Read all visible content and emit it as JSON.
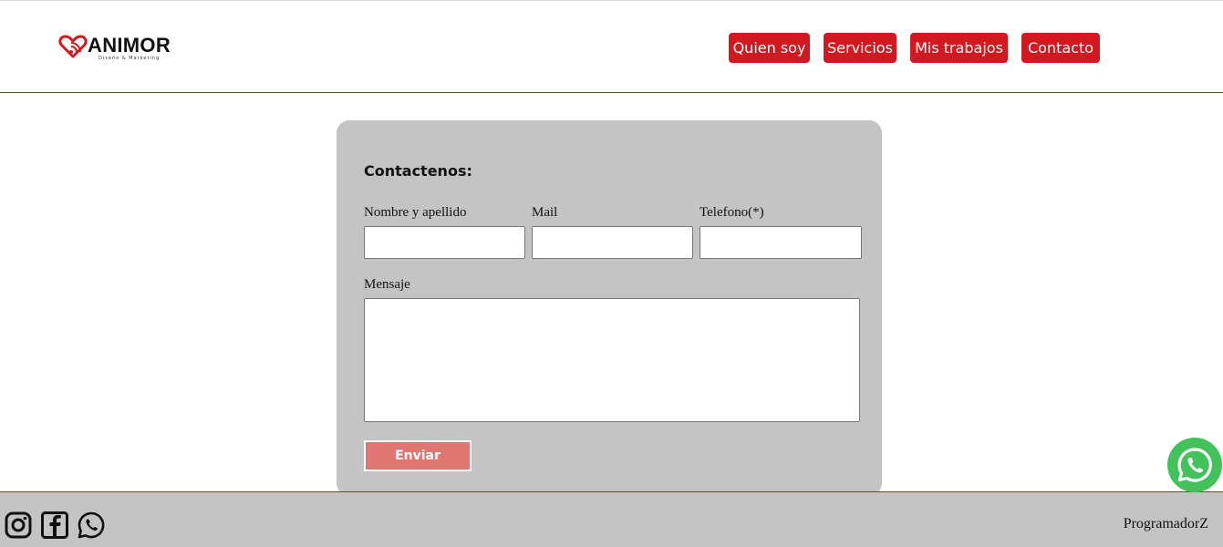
{
  "brand": {
    "name": "ANIMOR",
    "tagline": "Diseño & Marketing",
    "icon": "heart-wifi-logo"
  },
  "nav": {
    "items": [
      {
        "label": "Quien soy"
      },
      {
        "label": "Servicios"
      },
      {
        "label": "Mis trabajos"
      },
      {
        "label": "Contacto"
      }
    ]
  },
  "form": {
    "title": "Contactenos:",
    "name_label": "Nombre y apellido",
    "name_value": "",
    "mail_label": "Mail",
    "mail_value": "",
    "phone_label": "Telefono(*)",
    "phone_value": "",
    "message_label": "Mensaje",
    "message_value": "",
    "submit_label": "Enviar"
  },
  "footer": {
    "social_icons": [
      "instagram-icon",
      "facebook-icon",
      "whatsapp-icon"
    ],
    "credit": "ProgramadorZ"
  },
  "floating": {
    "icon": "whatsapp-icon"
  },
  "colors": {
    "accent": "#d2191f",
    "card_bg": "#c4c4c4",
    "submit_bg": "#e07672",
    "whatsapp": "#43c15a"
  }
}
